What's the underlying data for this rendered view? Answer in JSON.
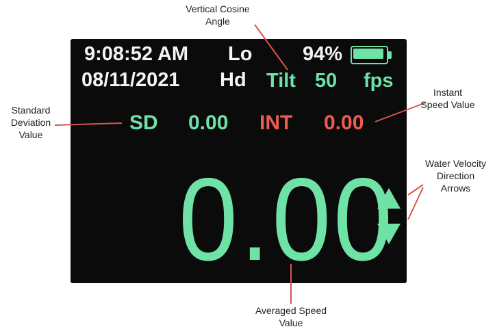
{
  "display": {
    "time": "9:08:52 AM",
    "range": "Lo",
    "battery_percent": "94%",
    "battery_level": 0.94,
    "date": "08/11/2021",
    "mode": "Hd",
    "tilt_label": "Tilt",
    "tilt_value": "50",
    "units": "fps",
    "sd_label": "SD",
    "sd_value": "0.00",
    "int_label": "INT",
    "int_value": "0.00",
    "averaged_speed": "0.00",
    "arrows": [
      "up-arrow",
      "down-arrow"
    ]
  },
  "callouts": {
    "tilt": [
      "Vertical Cosine",
      "Angle"
    ],
    "sd": [
      "Standard",
      "Deviation",
      "Value"
    ],
    "int": [
      "Instant",
      "Speed Value"
    ],
    "arrows": [
      "Water Velocity",
      "Direction",
      "Arrows"
    ],
    "avg": [
      "Averaged Speed",
      "Value"
    ]
  },
  "colors": {
    "screen_bg": "#0b0b0b",
    "green": "#6fe2a6",
    "red": "#f05a50",
    "white": "#f4f4f4",
    "leader": "#d9534f"
  }
}
